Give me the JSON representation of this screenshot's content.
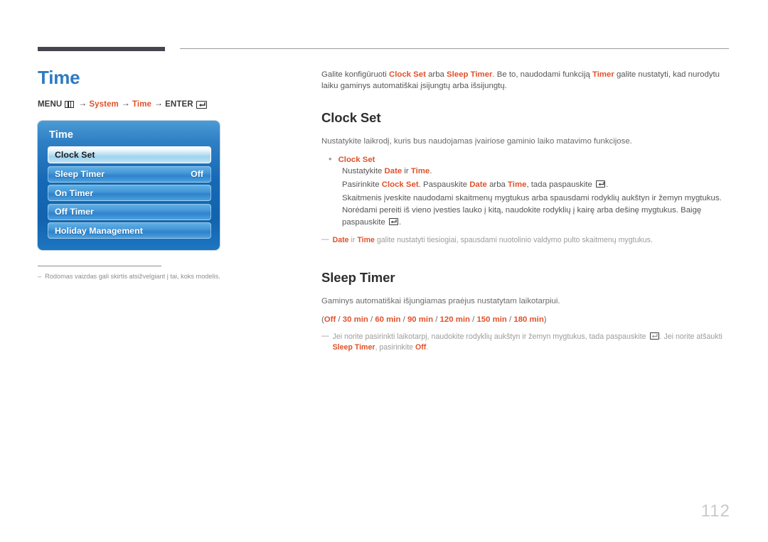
{
  "header": {
    "title": "Time",
    "breadcrumb": {
      "menu_label": "MENU",
      "menu_icon": "menu-grid-icon",
      "arrow": "→",
      "step1": "System",
      "step2": "Time",
      "enter_label": "ENTER",
      "enter_icon": "enter-key-icon"
    }
  },
  "osd": {
    "title": "Time",
    "items": [
      {
        "label": "Clock Set",
        "value": "",
        "selected": true
      },
      {
        "label": "Sleep Timer",
        "value": "Off",
        "selected": false
      },
      {
        "label": "On Timer",
        "value": "",
        "selected": false
      },
      {
        "label": "Off Timer",
        "value": "",
        "selected": false
      },
      {
        "label": "Holiday Management",
        "value": "",
        "selected": false
      }
    ]
  },
  "left_note": {
    "dash": "–",
    "text": "Rodomas vaizdas gali skirtis atsižvelgiant į tai, koks modelis."
  },
  "intro": {
    "part1": "Galite konfigūruoti ",
    "kw1": "Clock Set",
    "part2": " arba ",
    "kw2": "Sleep Timer",
    "part3": ". Be to, naudodami funkciją ",
    "kw3": "Timer",
    "part4": " galite nustatyti, kad nurodytu laiku gaminys automatiškai įsijungtų arba išsijungtų."
  },
  "clock_set": {
    "heading": "Clock Set",
    "description": "Nustatykite laikrodį, kuris bus naudojamas įvairiose gaminio laiko matavimo funkcijose.",
    "bullet_heading": "Clock Set",
    "line1_a": "Nustatykite ",
    "line1_kw1": "Date",
    "line1_b": " ir ",
    "line1_kw2": "Time",
    "line1_c": ".",
    "line2_a": "Pasirinkite ",
    "line2_kw1": "Clock Set",
    "line2_b": ". Paspauskite ",
    "line2_kw2": "Date",
    "line2_c": " arba ",
    "line2_kw3": "Time",
    "line2_d": ", tada paspauskite ",
    "line2_e": ".",
    "line3_a": "Skaitmenis įveskite naudodami skaitmenų mygtukus arba spausdami rodyklių aukštyn ir žemyn mygtukus. Norėdami pereiti iš vieno įvesties lauko į kitą, naudokite rodyklių į kairę arba dešinę mygtukus. Baigę paspauskite ",
    "line3_b": ".",
    "note_dash": "—",
    "note_kw1": "Date",
    "note_mid": " ir ",
    "note_kw2": "Time",
    "note_tail": " galite nustatyti tiesiogiai, spausdami nuotolinio valdymo pulto skaitmenų mygtukus."
  },
  "sleep_timer": {
    "heading": "Sleep Timer",
    "description": "Gaminys automatiškai išjungiamas praėjus nustatytam laikotarpiui.",
    "options_open": "(",
    "options": [
      "Off",
      "30 min",
      "60 min",
      "90 min",
      "120 min",
      "150 min",
      "180 min"
    ],
    "options_sep": " / ",
    "options_close": ")",
    "note_dash": "—",
    "note_a": "Jei norite pasirinkti laikotarpį, naudokite rodyklių aukštyn ir žemyn mygtukus, tada paspauskite ",
    "note_b": ". Jei norite atšaukti ",
    "note_kw1": "Sleep Timer",
    "note_c": ", pasirinkite ",
    "note_kw2": "Off",
    "note_d": "."
  },
  "footer": {
    "page_number": "112"
  },
  "colors": {
    "title_blue": "#2e7ac4",
    "accent_orange": "#e0522a",
    "rule_dark": "#45454f",
    "osd_blue": "#1669b5",
    "page_num_gray": "#c9c9c9"
  }
}
